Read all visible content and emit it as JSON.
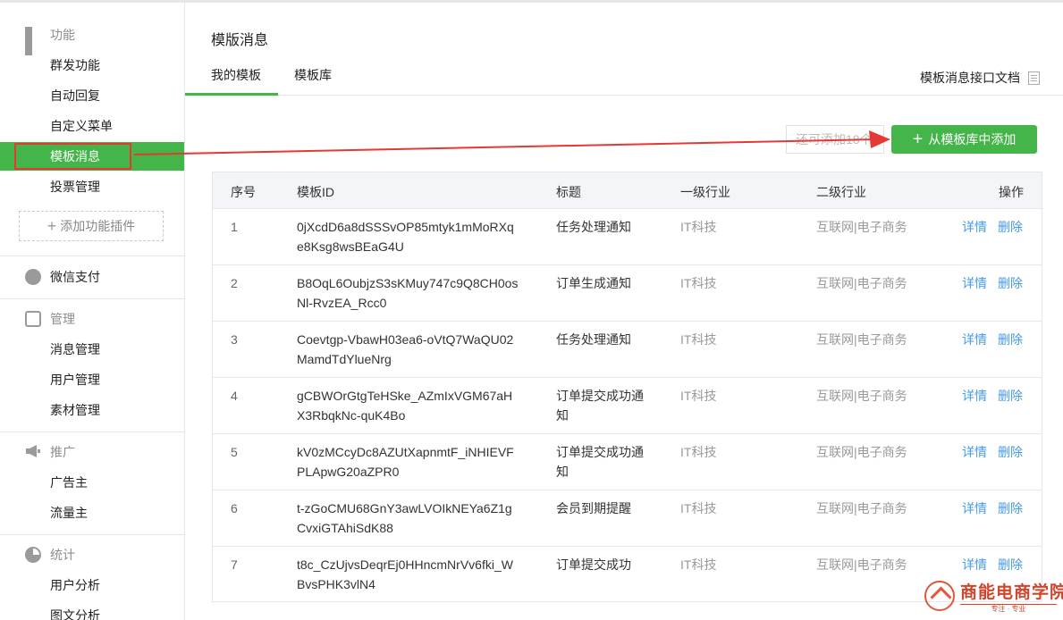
{
  "sidebar": {
    "groups": [
      {
        "title": "功能",
        "icon": "grid-icon",
        "items": [
          "群发功能",
          "自动回复",
          "自定义菜单",
          "模板消息",
          "投票管理"
        ],
        "add_plugin": "添加功能插件"
      },
      {
        "title": "微信支付",
        "icon": "wechat-pay-icon"
      },
      {
        "title": "管理",
        "icon": "tray-icon",
        "items": [
          "消息管理",
          "用户管理",
          "素材管理"
        ]
      },
      {
        "title": "推广",
        "icon": "megaphone-icon",
        "items": [
          "广告主",
          "流量主"
        ]
      },
      {
        "title": "统计",
        "icon": "pie-chart-icon",
        "items": [
          "用户分析",
          "图文分析"
        ]
      }
    ],
    "active_item": "模板消息"
  },
  "main": {
    "title": "模版消息",
    "tabs": [
      {
        "label": "我的模板",
        "active": true
      },
      {
        "label": "模板库",
        "active": false
      }
    ],
    "doc_link": "模板消息接口文档",
    "remaining_text": "还可添加18个",
    "add_button": "从模板库中添加",
    "table": {
      "headers": [
        "序号",
        "模板ID",
        "标题",
        "一级行业",
        "二级行业",
        "操作"
      ],
      "rows": [
        {
          "idx": "1",
          "id": "0jXcdD6a8dSSSvOP85mtyk1mMoRXqe8Ksg8wsBEaG4U",
          "title": "任务处理通知",
          "ind1": "IT科技",
          "ind2": "互联网|电子商务",
          "detail": "详情",
          "delete": "删除"
        },
        {
          "idx": "2",
          "id": "B8OqL6OubjzS3sKMuy747c9Q8CH0osNl-RvzEA_Rcc0",
          "title": "订单生成通知",
          "ind1": "IT科技",
          "ind2": "互联网|电子商务",
          "detail": "详情",
          "delete": "删除"
        },
        {
          "idx": "3",
          "id": "Coevtgp-VbawH03ea6-oVtQ7WaQU02MamdTdYlueNrg",
          "title": "任务处理通知",
          "ind1": "IT科技",
          "ind2": "互联网|电子商务",
          "detail": "详情",
          "delete": "删除"
        },
        {
          "idx": "4",
          "id": "gCBWOrGtgTeHSke_AZmIxVGM67aHX3RbqkNc-quK4Bo",
          "title": "订单提交成功通知",
          "ind1": "IT科技",
          "ind2": "互联网|电子商务",
          "detail": "详情",
          "delete": "删除"
        },
        {
          "idx": "5",
          "id": "kV0zMCcyDc8AZUtXapnmtF_iNHIEVFPLApwG20aZPR0",
          "title": "订单提交成功通知",
          "ind1": "IT科技",
          "ind2": "互联网|电子商务",
          "detail": "详情",
          "delete": "删除"
        },
        {
          "idx": "6",
          "id": "t-zGoCMU68GnY3awLVOIkNEYa6Z1gCvxiGTAhiSdK88",
          "title": "会员到期提醒",
          "ind1": "IT科技",
          "ind2": "互联网|电子商务",
          "detail": "详情",
          "delete": "删除"
        },
        {
          "idx": "7",
          "id": "t8c_CzUjvsDeqrEj0HHncmNrVv6fki_WBvsPHK3vlN4",
          "title": "订单提交成功",
          "ind1": "IT科技",
          "ind2": "互联网|电子商务",
          "detail": "详情",
          "delete": "删除"
        }
      ]
    }
  },
  "watermark": {
    "name": "商能电商学院",
    "slogan": "专注 · 专业"
  },
  "colors": {
    "accent": "#44b549",
    "link": "#459ae9",
    "annotation": "#e53935"
  }
}
